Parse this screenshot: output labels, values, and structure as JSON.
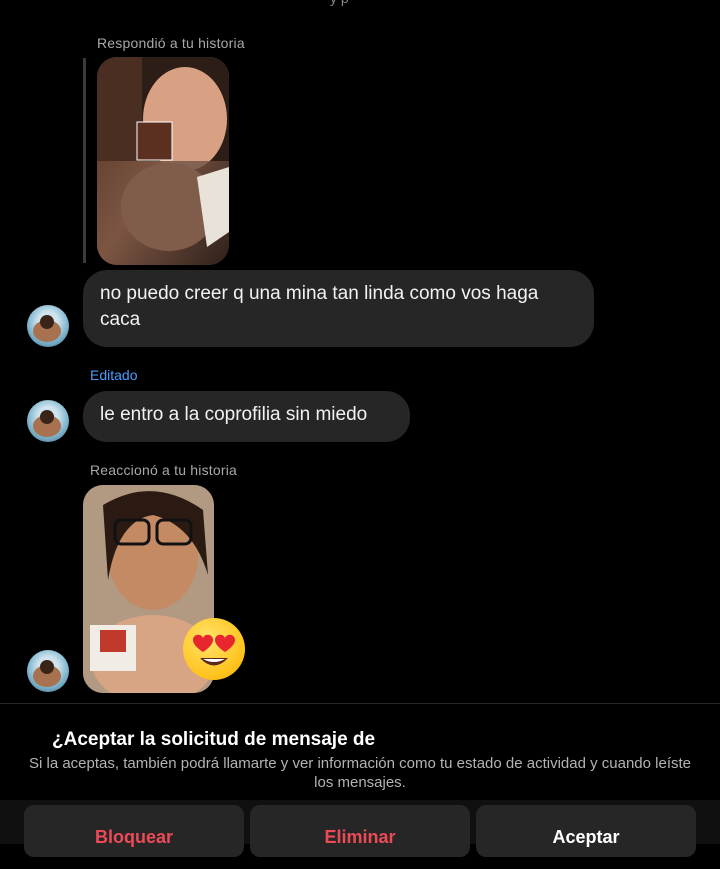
{
  "thread": {
    "top_cutoff_text": "y   p",
    "reply_story_label": "Respondió a tu historia",
    "message_1": "no puedo creer q una mina tan linda como vos haga caca",
    "edited_label": "Editado",
    "message_2": "le entro a la coprofilia sin miedo",
    "reaction_story_label": "Reaccionó a tu historia",
    "reaction_emoji": "heart-eyes-emoji"
  },
  "request": {
    "title": "¿Aceptar la solicitud de mensaje de",
    "description": "Si la aceptas, también podrá llamarte y ver información como tu estado de actividad y cuando leíste los mensajes.",
    "block_label": "Bloquear",
    "delete_label": "Eliminar",
    "accept_label": "Aceptar"
  },
  "colors": {
    "background": "#000000",
    "bubble": "#262626",
    "link_blue": "#4a9cff",
    "danger_red": "#ed4956"
  }
}
